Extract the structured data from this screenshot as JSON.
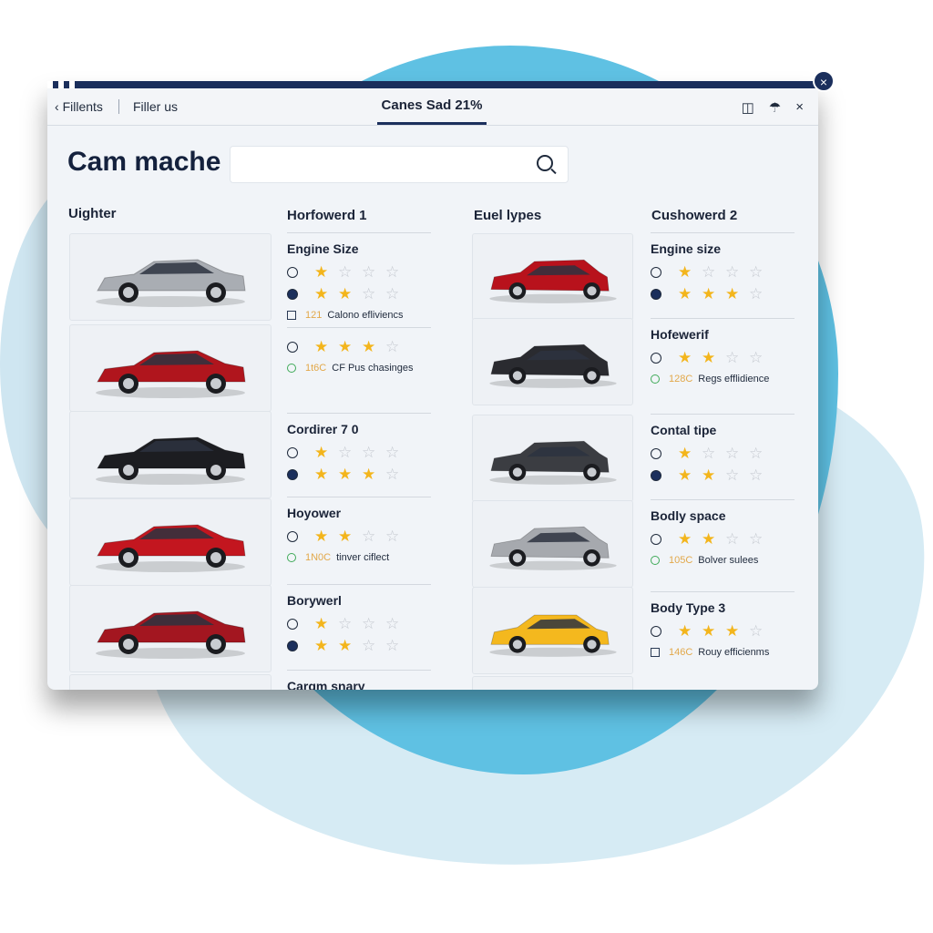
{
  "window": {
    "nav": {
      "back_label": "Fillents",
      "filter_label": "Filler us"
    },
    "active_tab": "Canes Sad 21%",
    "icons": [
      "columns-icon",
      "bell-icon",
      "close-icon"
    ],
    "close_x": "×",
    "close_circle": "×",
    "title": "Cam mache",
    "search": {
      "value": "",
      "placeholder": ""
    }
  },
  "columns": {
    "col1": "Uighter",
    "col2": "Horfowerd 1",
    "col3": "Euel lypes",
    "col4": "Cushowerd 2"
  },
  "left_cars": [
    {
      "color": "#a9adb3",
      "type": "sedan"
    },
    {
      "color": "#b0151d",
      "type": "sedan"
    },
    {
      "color": "#1c1d21",
      "type": "sedan"
    },
    {
      "color": "#c3161f",
      "type": "sedan"
    },
    {
      "color": "#a31620",
      "type": "sedan"
    }
  ],
  "right_cars": [
    {
      "color": "#b8121c",
      "type": "suv"
    },
    {
      "color": "#2a2b30",
      "type": "suv"
    },
    {
      "color": "#3b3d42",
      "type": "suv"
    },
    {
      "color": "#a6a9ae",
      "type": "suv"
    },
    {
      "color": "#f4b81e",
      "type": "hatch"
    }
  ],
  "specs_left": [
    {
      "title": "Engine Size",
      "ratings": [
        1,
        2
      ],
      "eff": {
        "num": "121",
        "text": "Calono efliviencs"
      }
    },
    {
      "title": "",
      "ratings": [
        3
      ],
      "eff": {
        "num": "1t6C",
        "text": "CF Pus chasinges"
      }
    },
    {
      "title": "Cordirer 7 0",
      "ratings": [
        1,
        3
      ],
      "eff": null
    },
    {
      "title": "Hoyower",
      "ratings": [
        2
      ],
      "eff": {
        "num": "1N0C",
        "text": "tinver ciflect"
      }
    },
    {
      "title": "Borywerl",
      "ratings": [
        1,
        2
      ],
      "eff": null
    },
    {
      "title": "Cargm snary",
      "ratings": [],
      "eff": null
    }
  ],
  "specs_right": [
    {
      "title": "Engine size",
      "ratings": [
        1,
        3
      ],
      "eff": null
    },
    {
      "title": "Hofewerif",
      "ratings": [
        2
      ],
      "eff": {
        "num": "128C",
        "text": "Regs efflidience"
      }
    },
    {
      "title": "Contal tipe",
      "ratings": [
        1,
        2
      ],
      "eff": null
    },
    {
      "title": "Bodly space",
      "ratings": [
        2
      ],
      "eff": {
        "num": "105C",
        "text": "Bolver sulees"
      }
    },
    {
      "title": "Body Type 3",
      "ratings": [
        3
      ],
      "eff": {
        "num": "146C",
        "text": "Rouy efficienms"
      }
    }
  ],
  "rating_max": 4
}
